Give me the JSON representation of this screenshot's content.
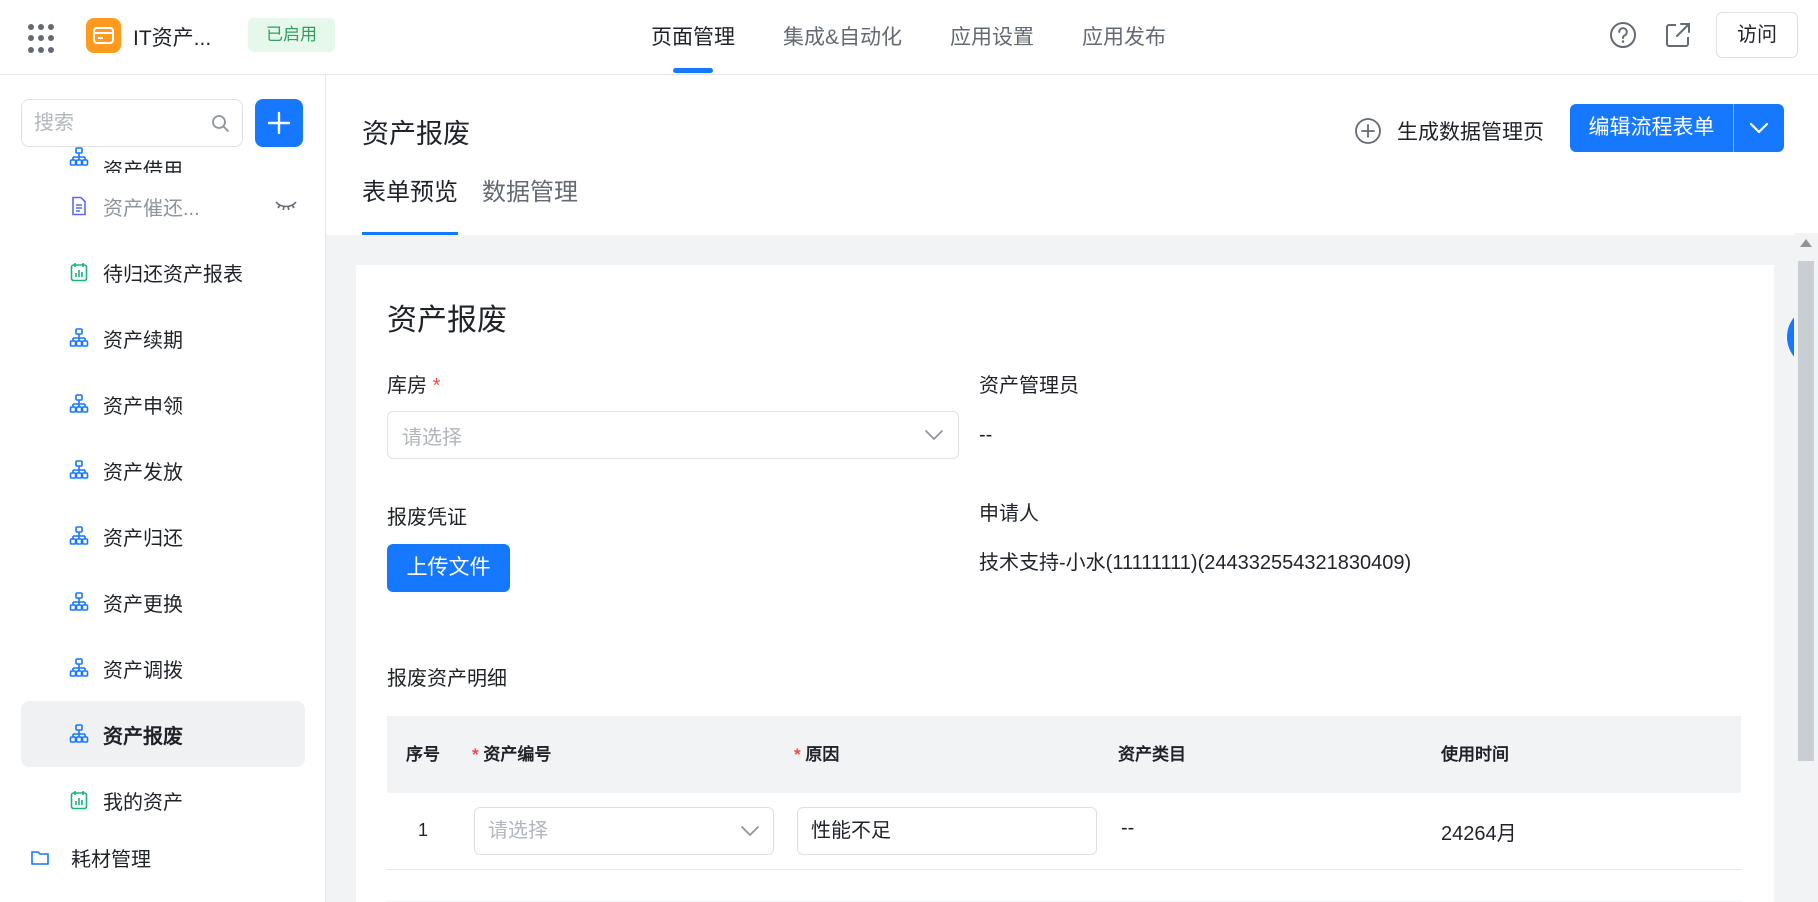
{
  "app": {
    "name": "IT资产...",
    "status": "已启用"
  },
  "top_tabs": [
    {
      "label": "页面管理"
    },
    {
      "label": "集成&自动化"
    },
    {
      "label": "应用设置"
    },
    {
      "label": "应用发布"
    }
  ],
  "visit_label": "访问",
  "sidebar": {
    "search_placeholder": "搜索",
    "items": [
      {
        "label": "资产借用",
        "icon": "workflow-icon"
      },
      {
        "label": "资产催还...",
        "icon": "document-icon"
      },
      {
        "label": "待归还资产报表",
        "icon": "report-icon"
      },
      {
        "label": "资产续期",
        "icon": "workflow-icon"
      },
      {
        "label": "资产申领",
        "icon": "workflow-icon"
      },
      {
        "label": "资产发放",
        "icon": "workflow-icon"
      },
      {
        "label": "资产归还",
        "icon": "workflow-icon"
      },
      {
        "label": "资产更换",
        "icon": "workflow-icon"
      },
      {
        "label": "资产调拨",
        "icon": "workflow-icon"
      },
      {
        "label": "资产报废",
        "icon": "workflow-icon"
      },
      {
        "label": "我的资产",
        "icon": "report-icon"
      },
      {
        "label": "耗材管理",
        "icon": "folder-icon"
      }
    ]
  },
  "page": {
    "title": "资产报废",
    "generate_label": "生成数据管理页",
    "edit_label": "编辑流程表单",
    "tabs": [
      {
        "label": "表单预览"
      },
      {
        "label": "数据管理"
      }
    ]
  },
  "form": {
    "title": "资产报废",
    "warehouse_label": "库房",
    "warehouse_placeholder": "请选择",
    "manager_label": "资产管理员",
    "manager_value": "--",
    "voucher_label": "报废凭证",
    "upload_label": "上传文件",
    "applicant_label": "申请人",
    "applicant_value": "技术支持-小水(11111111)(244332554321830409)",
    "detail_label": "报废资产明细",
    "table": {
      "headers": [
        "序号",
        "资产编号",
        "原因",
        "资产类目",
        "使用时间"
      ],
      "rows": [
        {
          "index": "1",
          "asset_no_placeholder": "请选择",
          "reason": "性能不足",
          "category": "--",
          "duration": "24264月"
        }
      ]
    }
  },
  "colors": {
    "primary": "#1677ff",
    "app_logo": "#ff9a1f",
    "status_bg": "#e6f7ec",
    "status_text": "#2ea15e",
    "required": "#f54a45"
  }
}
